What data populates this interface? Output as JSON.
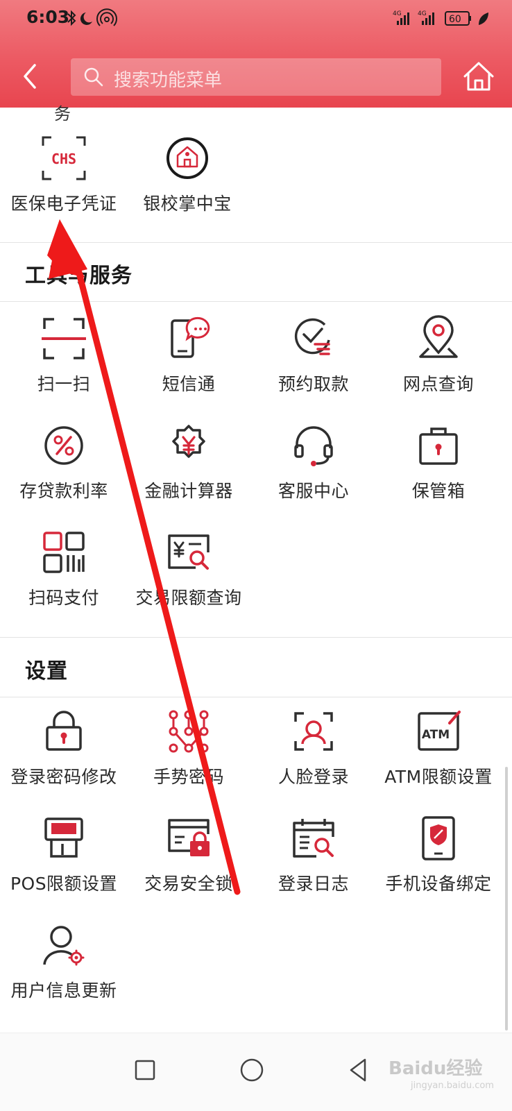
{
  "status_bar": {
    "time": "6:03",
    "battery": "60",
    "network_1": "4G",
    "network_2": "4G"
  },
  "header": {
    "search_placeholder": "搜索功能菜单"
  },
  "top_section": {
    "partial_label": "务",
    "items": [
      {
        "label": "医保电子凭证",
        "icon": "chs-icon"
      },
      {
        "label": "银校掌中宝",
        "icon": "school-icon"
      }
    ]
  },
  "tools_section": {
    "title": "工具与服务",
    "items": [
      {
        "label": "扫一扫",
        "icon": "scan-icon"
      },
      {
        "label": "短信通",
        "icon": "sms-phone-icon"
      },
      {
        "label": "预约取款",
        "icon": "clock-coin-icon"
      },
      {
        "label": "网点查询",
        "icon": "location-icon"
      },
      {
        "label": "存贷款利率",
        "icon": "percent-icon"
      },
      {
        "label": "金融计算器",
        "icon": "yen-gear-icon"
      },
      {
        "label": "客服中心",
        "icon": "headset-icon"
      },
      {
        "label": "保管箱",
        "icon": "safe-box-icon"
      },
      {
        "label": "扫码支付",
        "icon": "qr-code-icon"
      },
      {
        "label": "交易限额查询",
        "icon": "limit-search-icon"
      }
    ]
  },
  "settings_section": {
    "title": "设置",
    "items": [
      {
        "label": "登录密码修改",
        "icon": "lock-icon"
      },
      {
        "label": "手势密码",
        "icon": "gesture-icon"
      },
      {
        "label": "人脸登录",
        "icon": "face-icon"
      },
      {
        "label": "ATM限额设置",
        "icon": "atm-icon"
      },
      {
        "label": "POS限额设置",
        "icon": "pos-icon"
      },
      {
        "label": "交易安全锁",
        "icon": "card-lock-icon"
      },
      {
        "label": "登录日志",
        "icon": "calendar-search-icon"
      },
      {
        "label": "手机设备绑定",
        "icon": "phone-shield-icon"
      },
      {
        "label": "用户信息更新",
        "icon": "user-gear-icon"
      }
    ]
  },
  "icon_texts": {
    "chs": "CHS",
    "atm": "ATM"
  },
  "bottom_nav": {
    "watermark": "Baidu经验",
    "watermark_sub": "jingyan.baidu.com"
  },
  "colors": {
    "accent": "#d6283a",
    "header_gradient_top": "#f07a80",
    "header_gradient_bottom": "#e8454f",
    "icon_dark": "#2f2f2f",
    "annotation_arrow": "#ee1a1a"
  }
}
